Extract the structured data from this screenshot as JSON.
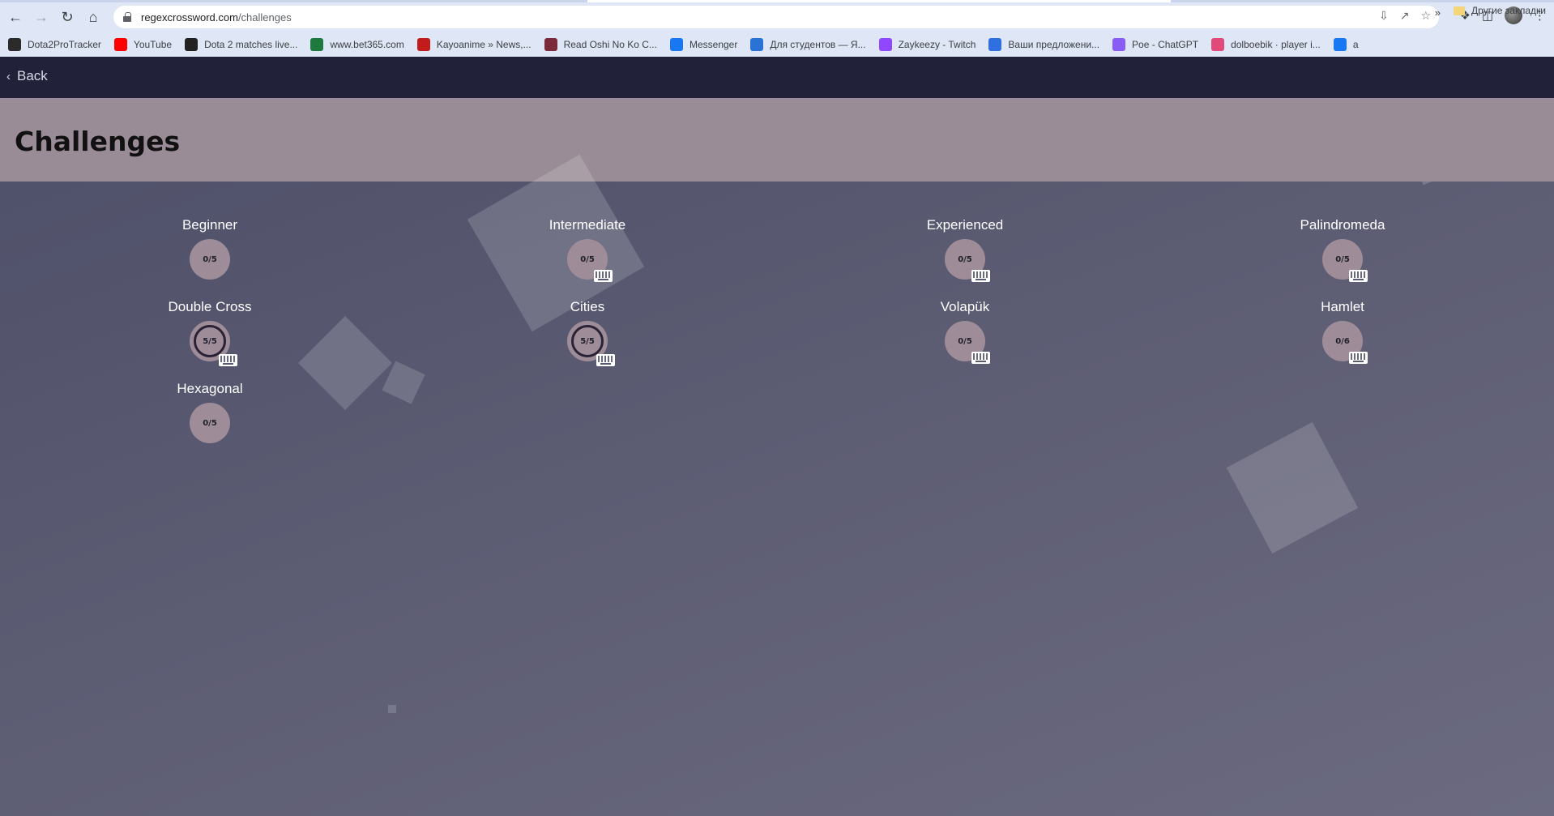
{
  "browser": {
    "url_host": "regexcrossword.com",
    "url_path": "/challenges",
    "bookmarks": [
      {
        "label": "Dota2ProTracker",
        "color": "#2b2b2b"
      },
      {
        "label": "YouTube",
        "color": "#ff0000"
      },
      {
        "label": "Dota 2 matches live...",
        "color": "#222222"
      },
      {
        "label": "www.bet365.com",
        "color": "#1e7a3c"
      },
      {
        "label": "Kayoanime » News,...",
        "color": "#c21b1b"
      },
      {
        "label": "Read Oshi No Ko C...",
        "color": "#7a2a3a"
      },
      {
        "label": "Messenger",
        "color": "#1877f2"
      },
      {
        "label": "Для студентов — Я...",
        "color": "#2a72d6"
      },
      {
        "label": "Zaykeezy - Twitch",
        "color": "#9146ff"
      },
      {
        "label": "Ваши предложени...",
        "color": "#2f6fe0"
      },
      {
        "label": "Poe - ChatGPT",
        "color": "#8a5cf6"
      },
      {
        "label": "dolboebik · player i...",
        "color": "#e0497a"
      },
      {
        "label": "a",
        "color": "#1877f2"
      }
    ],
    "more": "»",
    "other_bookmarks": "Другие закладки"
  },
  "page": {
    "back_label": "Back",
    "title": "Challenges"
  },
  "challenges": [
    {
      "name": "Beginner",
      "progress": "0/5",
      "complete": false,
      "keyboard": false
    },
    {
      "name": "Intermediate",
      "progress": "0/5",
      "complete": false,
      "keyboard": true
    },
    {
      "name": "Experienced",
      "progress": "0/5",
      "complete": false,
      "keyboard": true
    },
    {
      "name": "Palindromeda",
      "progress": "0/5",
      "complete": false,
      "keyboard": true
    },
    {
      "name": "Double Cross",
      "progress": "5/5",
      "complete": true,
      "keyboard": true
    },
    {
      "name": "Cities",
      "progress": "5/5",
      "complete": true,
      "keyboard": true
    },
    {
      "name": "Volapük",
      "progress": "0/5",
      "complete": false,
      "keyboard": true
    },
    {
      "name": "Hamlet",
      "progress": "0/6",
      "complete": false,
      "keyboard": true
    },
    {
      "name": "Hexagonal",
      "progress": "0/5",
      "complete": false,
      "keyboard": false
    }
  ],
  "colors": {
    "header_band": "#9a8c96",
    "topbar": "#21213a",
    "badge": "#9e8d98"
  }
}
